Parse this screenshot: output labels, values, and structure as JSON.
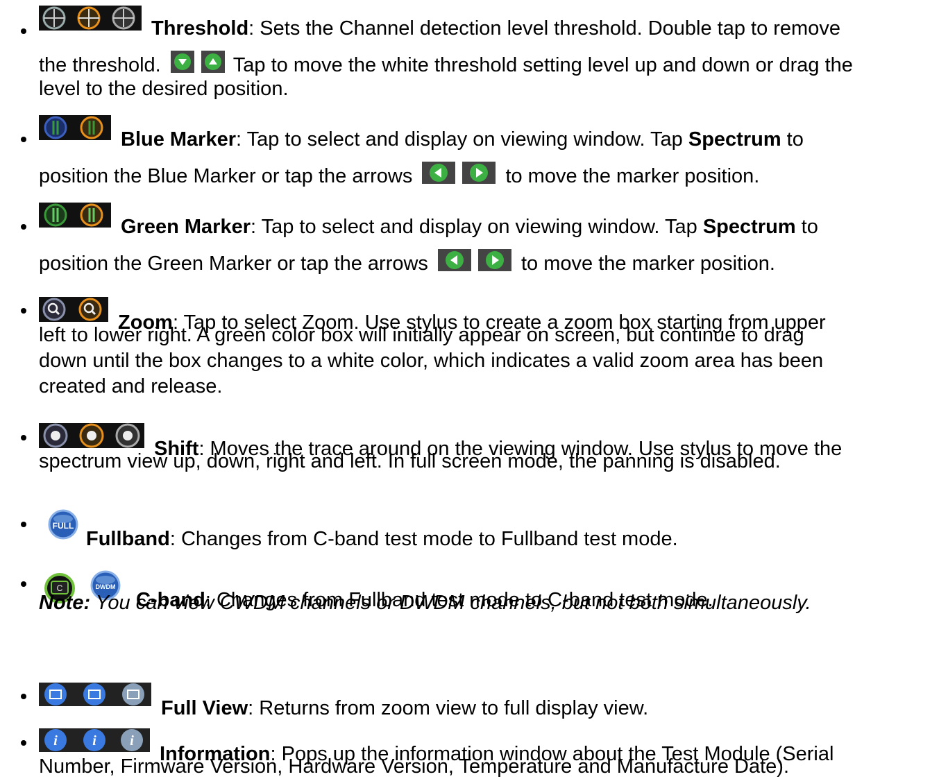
{
  "items": [
    {
      "icons": [
        "threshold-black-icon",
        "threshold-orange-icon",
        "threshold-gray-icon"
      ],
      "title": "Threshold",
      "line1": ":  Sets the Channel detection level threshold. Double tap to remove",
      "line2a": "the threshold.",
      "inline_icons": [
        "arrow-down-green-icon",
        "arrow-up-green-icon"
      ],
      "line2b": "Tap to move the white threshold setting level up and down or drag the",
      "line3": "level to the desired position."
    },
    {
      "icons": [
        "blue-marker-icon",
        "blue-marker-orange-icon"
      ],
      "title": "Blue Marker",
      "line1": ": Tap to select and display on viewing window. Tap ",
      "bold2": "Spectrum",
      "line1b": " to",
      "line2a": "position the Blue Marker or tap the arrows",
      "inline_icons": [
        "arrow-left-green-icon",
        "arrow-right-green-icon"
      ],
      "line2b": "to move the marker position."
    },
    {
      "icons": [
        "green-marker-icon",
        "green-marker-orange-icon"
      ],
      "title": "Green Marker",
      "line1": ": Tap to select and display on viewing window. Tap ",
      "bold2": "Spectrum",
      "line1b": " to",
      "line2a": "position the Green Marker or tap the arrows",
      "inline_icons": [
        "arrow-left-green-icon",
        "arrow-right-green-icon"
      ],
      "line2b": "to move the marker position."
    },
    {
      "icons": [
        "zoom-icon",
        "zoom-orange-icon"
      ],
      "title": "Zoom",
      "line1": ": Tap to select Zoom. Use stylus to create a zoom box starting from upper",
      "line2": "left to lower right. A green color box will initially appear on screen, but continue to drag",
      "line3": "down until the box changes to a white color, which indicates a valid zoom area has been",
      "line4": "created and release."
    },
    {
      "icons": [
        "shift-icon",
        "shift-orange-icon",
        "shift-gray-icon"
      ],
      "title": "Shift",
      "line1": ": Moves the trace around on the viewing window. Use stylus to move the",
      "line2": "spectrum view up, down, right and left. In full screen mode, the panning is disabled."
    },
    {
      "icons": [
        "fullband-icon"
      ],
      "icon_label": "FULL",
      "title": "Fullband",
      "line1": ": Changes from C-band test mode to Fullband test mode."
    },
    {
      "icons": [
        "c-band-icon",
        "dwdm-icon"
      ],
      "icon_labels": [
        "C",
        "DWDM"
      ],
      "title": "C-band",
      "line1": ": Changes from Fullband test mode to C-band test mode."
    },
    {
      "icons": [
        "full-view-icon",
        "full-view-blue-icon",
        "full-view-gray-icon"
      ],
      "title": "Full View",
      "line1": ": Returns from zoom view to full display view."
    },
    {
      "icons": [
        "info-icon",
        "info-blue-icon",
        "info-gray-icon"
      ],
      "title": "Information",
      "line1": ": Pops up the information window about the Test Module (Serial",
      "line2": "Number, Firmware Version, Hardware Version, Temperature and Manufacture Date)."
    }
  ],
  "note": {
    "label": "Note:",
    "text": " You can view CWDM channels or DWDM channels, but not both simultaneously."
  }
}
